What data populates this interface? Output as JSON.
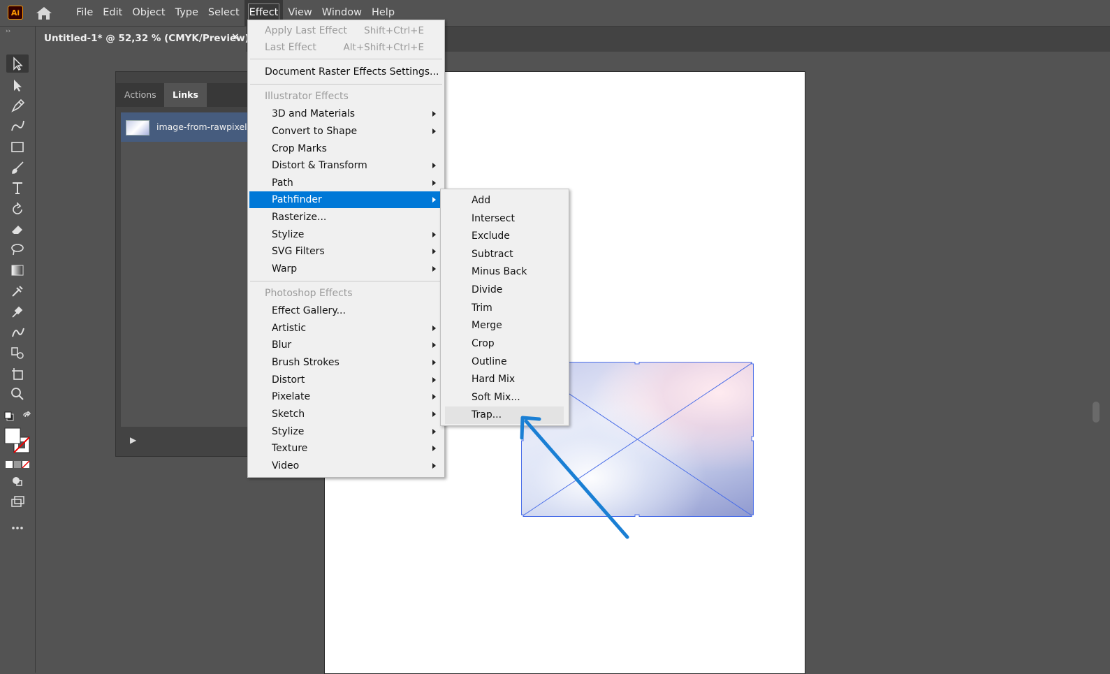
{
  "app": {
    "logo_text": "Ai",
    "accent": "#ff9a00"
  },
  "menubar": [
    "File",
    "Edit",
    "Object",
    "Type",
    "Select",
    "Effect",
    "View",
    "Window",
    "Help"
  ],
  "document_tab": {
    "title": "Untitled-1* @ 52,32 % (CMYK/Preview)",
    "close": "×"
  },
  "links_panel": {
    "tabs": [
      "Actions",
      "Links"
    ],
    "active_tab": "Links",
    "link_name": "image-from-rawpixel-id-"
  },
  "effect_menu": {
    "apply_last": {
      "label": "Apply Last Effect",
      "shortcut": "Shift+Ctrl+E"
    },
    "last": {
      "label": "Last Effect",
      "shortcut": "Alt+Shift+Ctrl+E"
    },
    "raster_settings": "Document Raster Effects Settings...",
    "illustrator_header": "Illustrator Effects",
    "illustrator_items": [
      "3D and Materials",
      "Convert to Shape",
      "Crop Marks",
      "Distort & Transform",
      "Path",
      "Pathfinder",
      "Rasterize...",
      "Stylize",
      "SVG Filters",
      "Warp"
    ],
    "photoshop_header": "Photoshop Effects",
    "photoshop_items": [
      "Effect Gallery...",
      "Artistic",
      "Blur",
      "Brush Strokes",
      "Distort",
      "Pixelate",
      "Sketch",
      "Stylize",
      "Texture",
      "Video"
    ],
    "highlighted": "Pathfinder",
    "highlight_color": "#0078d7"
  },
  "pathfinder_submenu": [
    "Add",
    "Intersect",
    "Exclude",
    "Subtract",
    "Minus Back",
    "Divide",
    "Trim",
    "Merge",
    "Crop",
    "Outline",
    "Hard Mix",
    "Soft Mix...",
    "Trap..."
  ],
  "annotation": {
    "color": "#1a7fd4"
  }
}
